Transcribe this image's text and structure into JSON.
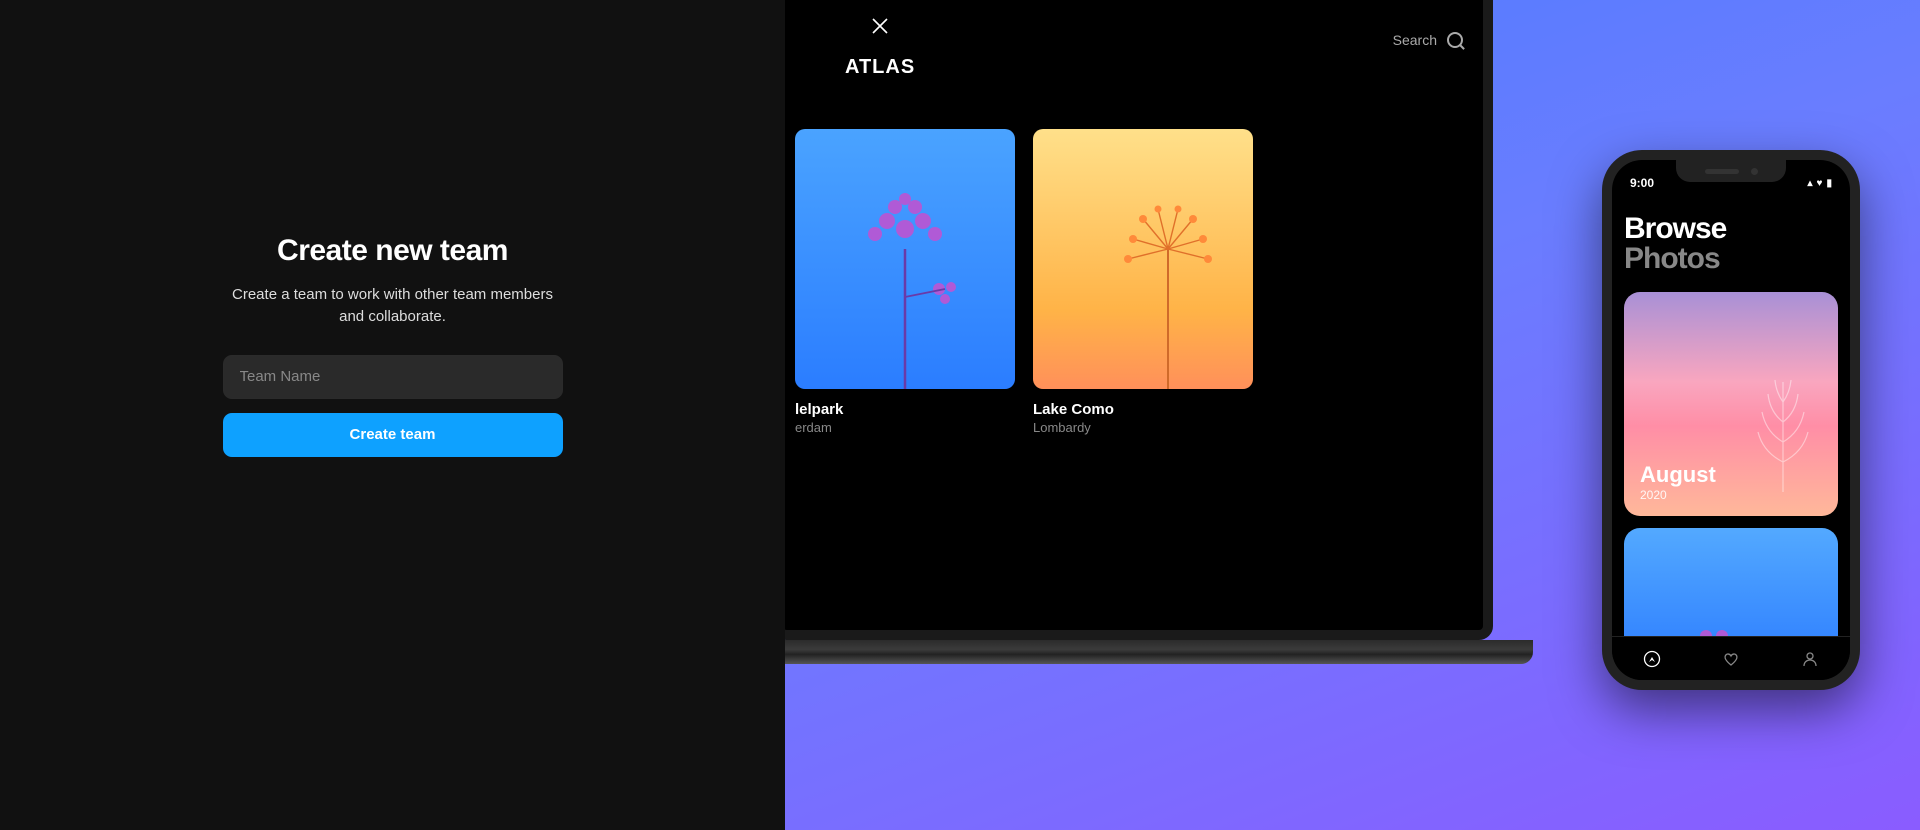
{
  "form": {
    "title": "Create new team",
    "subtitle": "Create a team to work with other team members and collaborate.",
    "placeholder": "Team Name",
    "submit": "Create team"
  },
  "laptop": {
    "brand": "ATLAS",
    "search_label": "Search",
    "cards": [
      {
        "title_fragment": "lelpark",
        "subtitle_fragment": "erdam"
      },
      {
        "title": "Lake Como",
        "subtitle": "Lombardy"
      }
    ]
  },
  "phone": {
    "time": "9:00",
    "headline1": "Browse",
    "headline2": "Photos",
    "card": {
      "month": "August",
      "year": "2020"
    }
  }
}
